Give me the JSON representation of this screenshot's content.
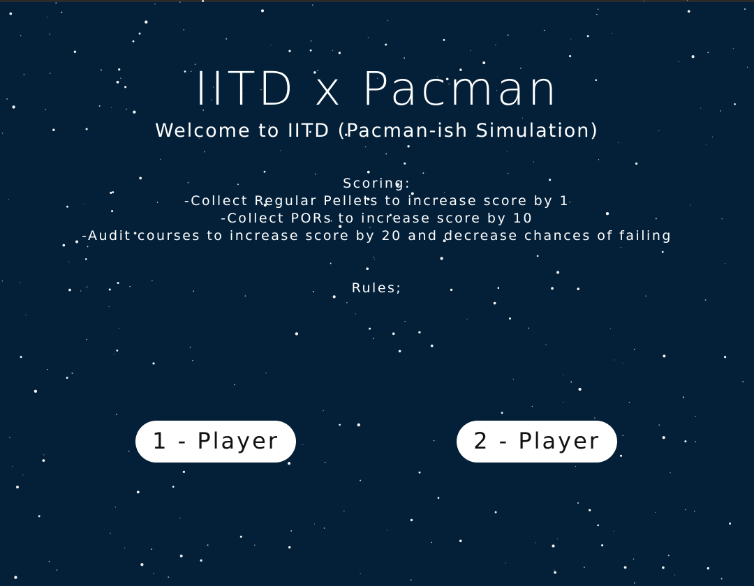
{
  "screen": {
    "background_color": "#032038",
    "text_color": "#ffffff",
    "button_color": "#ffffff",
    "button_text_color": "#111111"
  },
  "title": "IITD x Pacman",
  "subtitle": "Welcome to IITD (Pacman-ish Simulation)",
  "scoring": {
    "heading": "Scoring:",
    "lines": [
      "-Collect Regular Pellets to increase score by 1",
      "-Collect PORs to increase score by 10",
      "-Audit courses to increase score by 20 and decrease chances of failing"
    ]
  },
  "rules": {
    "heading": "Rules;"
  },
  "buttons": {
    "one_player": "1 - Player",
    "two_player": "2 - Player"
  }
}
